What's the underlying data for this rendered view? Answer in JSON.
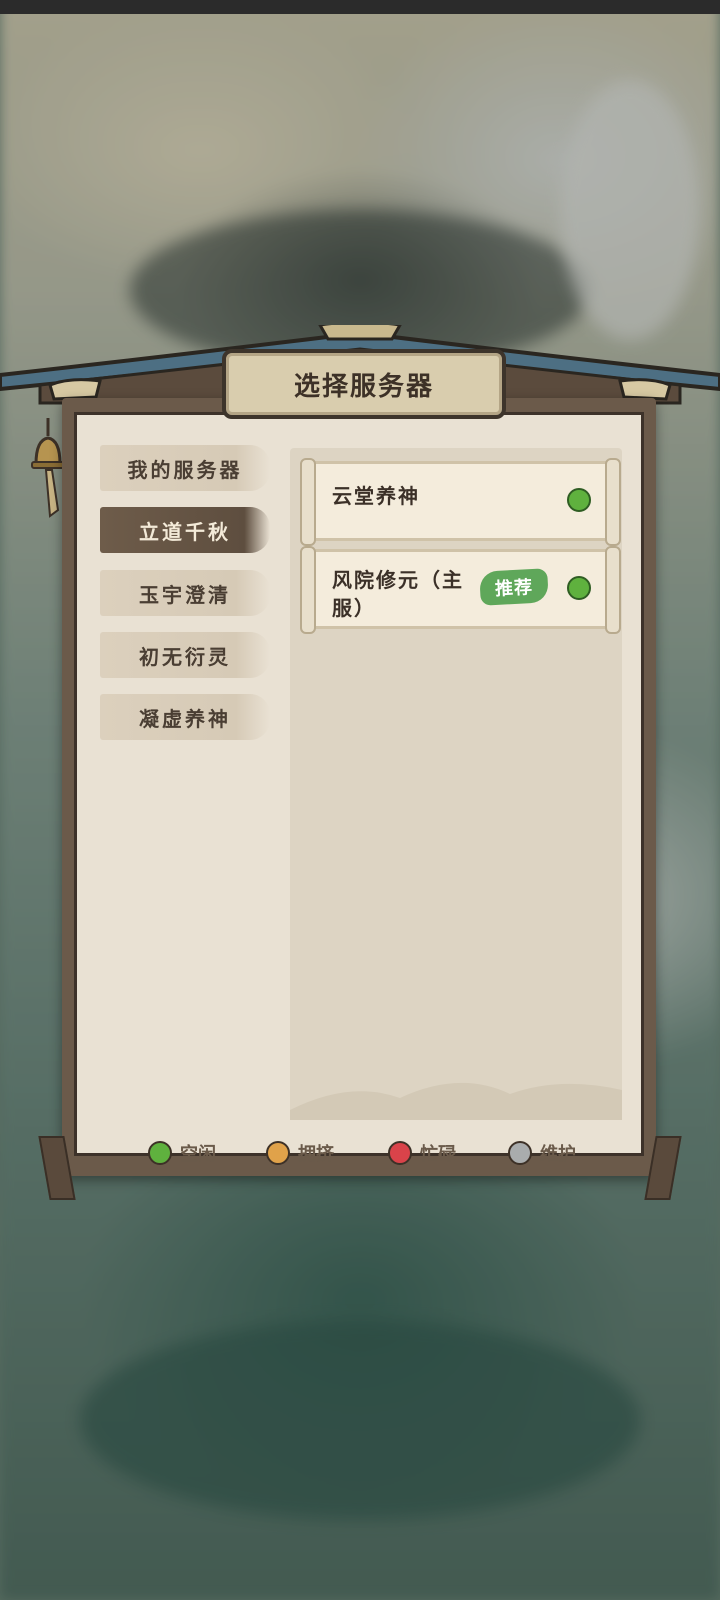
{
  "dialog": {
    "title": "选择服务器"
  },
  "tabs": [
    {
      "label": "我的服务器",
      "active": false
    },
    {
      "label": "立道千秋",
      "active": true
    },
    {
      "label": "玉宇澄清",
      "active": false
    },
    {
      "label": "初无衍灵",
      "active": false
    },
    {
      "label": "凝虚养神",
      "active": false
    }
  ],
  "servers": [
    {
      "name": "云堂养神",
      "status": "idle",
      "badge": ""
    },
    {
      "name": "风院修元（主服）",
      "status": "idle",
      "badge": "推荐"
    }
  ],
  "legend": [
    {
      "label": "空闲",
      "color": "#5fb13e"
    },
    {
      "label": "拥挤",
      "color": "#e0a24a"
    },
    {
      "label": "忙碌",
      "color": "#d9434a"
    },
    {
      "label": "维护",
      "color": "#a9acad"
    }
  ]
}
